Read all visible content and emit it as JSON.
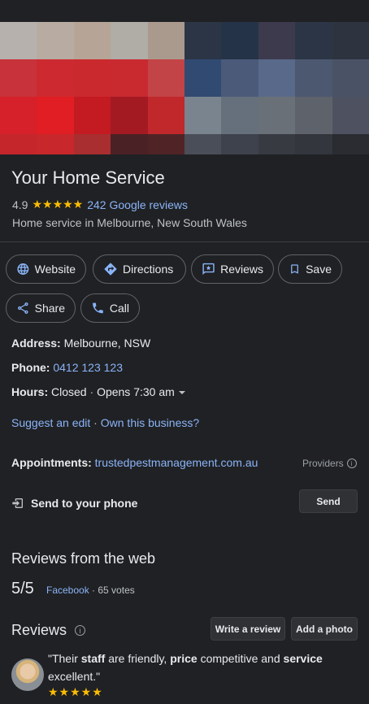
{
  "place": {
    "name": "Your Home Service",
    "rating": "4.9",
    "stars": "★★★★★",
    "reviews_link": "242 Google reviews",
    "category": "Home service in Melbourne, New South Wales"
  },
  "actions": {
    "website": "Website",
    "directions": "Directions",
    "reviews": "Reviews",
    "save": "Save",
    "share": "Share",
    "call": "Call"
  },
  "details": {
    "address_label": "Address:",
    "address_value": "Melbourne, NSW",
    "phone_label": "Phone:",
    "phone_value": "0412 123 123",
    "hours_label": "Hours:",
    "hours_status": "Closed",
    "hours_sep": " · ",
    "hours_opens": "Opens 7:30 am",
    "suggest_edit": "Suggest an edit",
    "link_sep": " · ",
    "own_business": "Own this business?",
    "appointments_label": "Appointments:",
    "appointments_value": "trustedpestmanagement.com.au",
    "providers": "Providers"
  },
  "send": {
    "label": "Send to your phone",
    "button": "Send"
  },
  "web_reviews": {
    "title": "Reviews from the web",
    "score": "5/5",
    "source": "Facebook",
    "votes": "· 65 votes"
  },
  "reviews": {
    "title": "Reviews",
    "write_button": "Write a review",
    "photo_button": "Add a photo",
    "quote_open": "\"Their ",
    "kw1": "staff",
    "mid1": " are friendly, ",
    "kw2": "price",
    "mid2": " competitive and ",
    "kw3": "service",
    "quote_close": " excellent.\"",
    "stars": "★★★★★"
  },
  "colors": {
    "background": "#202124",
    "link": "#8ab4f8",
    "star": "#fbbc04"
  }
}
